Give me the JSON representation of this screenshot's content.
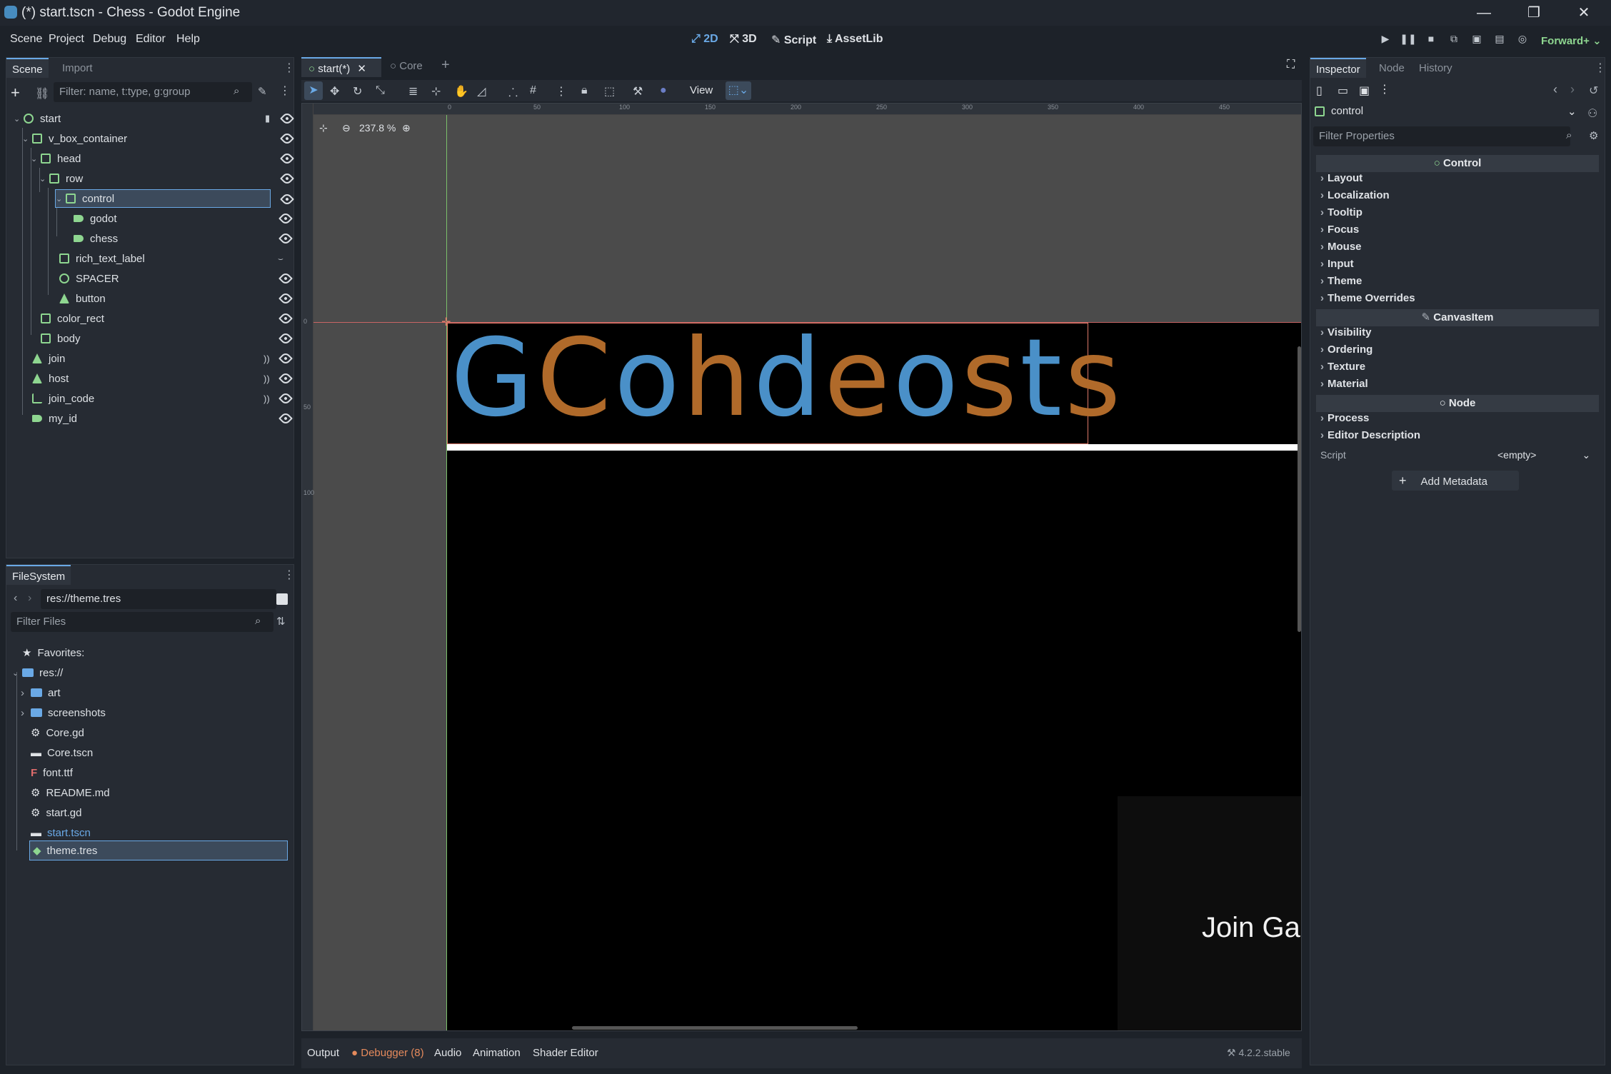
{
  "window": {
    "title": "(*) start.tscn - Chess - Godot Engine",
    "minimize": "—",
    "restore": "❐",
    "close": "✕"
  },
  "menu": [
    "Scene",
    "Project",
    "Debug",
    "Editor",
    "Help"
  ],
  "modes": {
    "m2d": "2D",
    "m3d": "3D",
    "script": "Script",
    "assetlib": "AssetLib"
  },
  "renderer": "Forward+",
  "scene_dock": {
    "tabs": [
      "Scene",
      "Import"
    ],
    "filter_placeholder": "Filter: name, t:type, g:group",
    "nodes": [
      {
        "label": "start",
        "depth": 0
      },
      {
        "label": "v_box_container",
        "depth": 1
      },
      {
        "label": "head",
        "depth": 2
      },
      {
        "label": "row",
        "depth": 3
      },
      {
        "label": "control",
        "depth": 4
      },
      {
        "label": "godot",
        "depth": 5
      },
      {
        "label": "chess",
        "depth": 5
      },
      {
        "label": "rich_text_label",
        "depth": 4
      },
      {
        "label": "SPACER",
        "depth": 4
      },
      {
        "label": "button",
        "depth": 4
      },
      {
        "label": "color_rect",
        "depth": 2
      },
      {
        "label": "body",
        "depth": 2
      },
      {
        "label": "join",
        "depth": 1
      },
      {
        "label": "host",
        "depth": 1
      },
      {
        "label": "join_code",
        "depth": 1
      },
      {
        "label": "my_id",
        "depth": 1
      }
    ]
  },
  "filesystem": {
    "title": "FileSystem",
    "path": "res://theme.tres",
    "filter_placeholder": "Filter Files",
    "favorites": "Favorites:",
    "root": "res://",
    "items": [
      {
        "label": "art",
        "kind": "folder"
      },
      {
        "label": "screenshots",
        "kind": "folder"
      },
      {
        "label": "Core.gd",
        "kind": "gear"
      },
      {
        "label": "Core.tscn",
        "kind": "scene"
      },
      {
        "label": "font.ttf",
        "kind": "font"
      },
      {
        "label": "README.md",
        "kind": "gear"
      },
      {
        "label": "start.gd",
        "kind": "gear"
      },
      {
        "label": "start.tscn",
        "kind": "scene"
      },
      {
        "label": "theme.tres",
        "kind": "theme"
      }
    ]
  },
  "editor_tabs": {
    "tab1": "start(*)",
    "tab2": "Core"
  },
  "toolbar": {
    "view": "View"
  },
  "viewport": {
    "zoom": "237.8 %",
    "logo_text": "GCohdeosts",
    "logo_colors": [
      "#4a90c8",
      "#b06a2a"
    ],
    "join_text": "Join Gar",
    "ruler_ticks": [
      "0",
      "50",
      "100",
      "150",
      "200",
      "250",
      "300",
      "350",
      "400",
      "450"
    ],
    "ruler_ticks_v": [
      "0",
      "50",
      "100"
    ]
  },
  "bottom_tabs": [
    "Output",
    "Debugger (8)",
    "Audio",
    "Animation",
    "Shader Editor"
  ],
  "version": "4.2.2.stable",
  "inspector": {
    "tabs": [
      "Inspector",
      "Node",
      "History"
    ],
    "object": "control",
    "filter_placeholder": "Filter Properties",
    "sections": [
      {
        "title": "Control",
        "items": [
          "Layout",
          "Localization",
          "Tooltip",
          "Focus",
          "Mouse",
          "Input",
          "Theme",
          "Theme Overrides"
        ]
      },
      {
        "title": "CanvasItem",
        "items": [
          "Visibility",
          "Ordering",
          "Texture",
          "Material"
        ]
      },
      {
        "title": "Node",
        "items": [
          "Process",
          "Editor Description"
        ]
      }
    ],
    "script_label": "Script",
    "script_value": "<empty>",
    "add_metadata": "Add Metadata"
  }
}
